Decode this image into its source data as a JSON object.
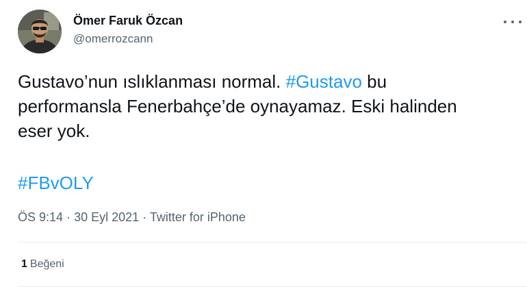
{
  "author": {
    "name": "Ömer Faruk Özcan",
    "handle": "@omerrozcann",
    "avatar_icon": "profile-photo"
  },
  "more_icon": "ellipsis-icon",
  "tweet": {
    "line1_pre": "Gustavo’nun ıslıklanması normal. ",
    "line1_hashtag": "#Gustavo",
    "line1_post": " bu",
    "line2": "performansla Fenerbahçe’de oynayamaz. Eski halinden",
    "line3": "eser yok.",
    "hashtag2": "#FBvOLY"
  },
  "meta": {
    "time": "ÖS 9:14",
    "date": "30 Eyl 2021",
    "source": "Twitter for iPhone",
    "separator": "·"
  },
  "engagement": {
    "likes_count": "1",
    "likes_label": "Beğeni"
  },
  "colors": {
    "link": "#1d9bf0",
    "text": "#0f1419",
    "secondary": "#536471",
    "divider": "#e7ebee"
  }
}
